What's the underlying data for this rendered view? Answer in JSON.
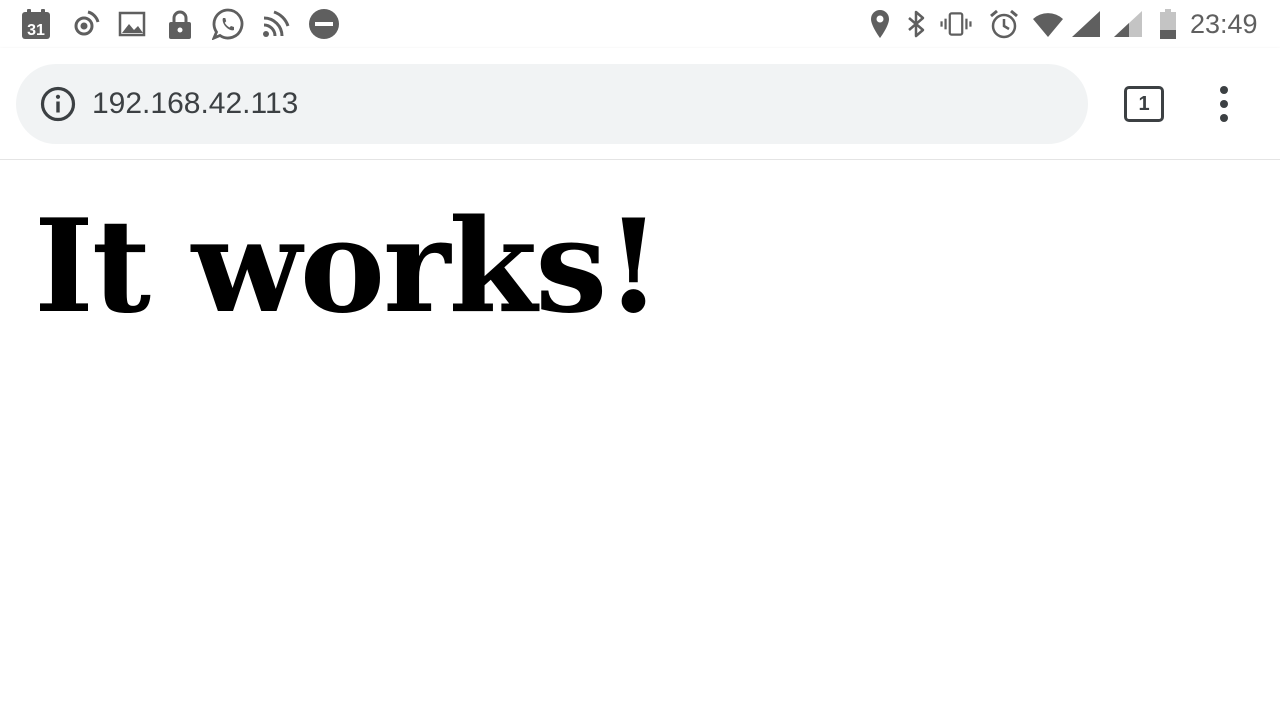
{
  "status_bar": {
    "calendar_day": "31",
    "clock": "23:49",
    "left_icons": [
      "calendar-icon",
      "hotspot-icon",
      "image-icon",
      "lock-icon",
      "whatsapp-icon",
      "cast-icon",
      "do-not-disturb-icon"
    ],
    "right_icons": [
      "location-icon",
      "bluetooth-icon",
      "vibrate-icon",
      "alarm-icon",
      "wifi-icon",
      "signal-icon",
      "signal-weak-icon",
      "battery-icon"
    ],
    "icon_color": "#5f5f5f"
  },
  "toolbar": {
    "url": "192.168.42.113",
    "tab_count": "1",
    "omnibox_color": "#f1f3f4"
  },
  "page": {
    "heading": "It works!"
  }
}
